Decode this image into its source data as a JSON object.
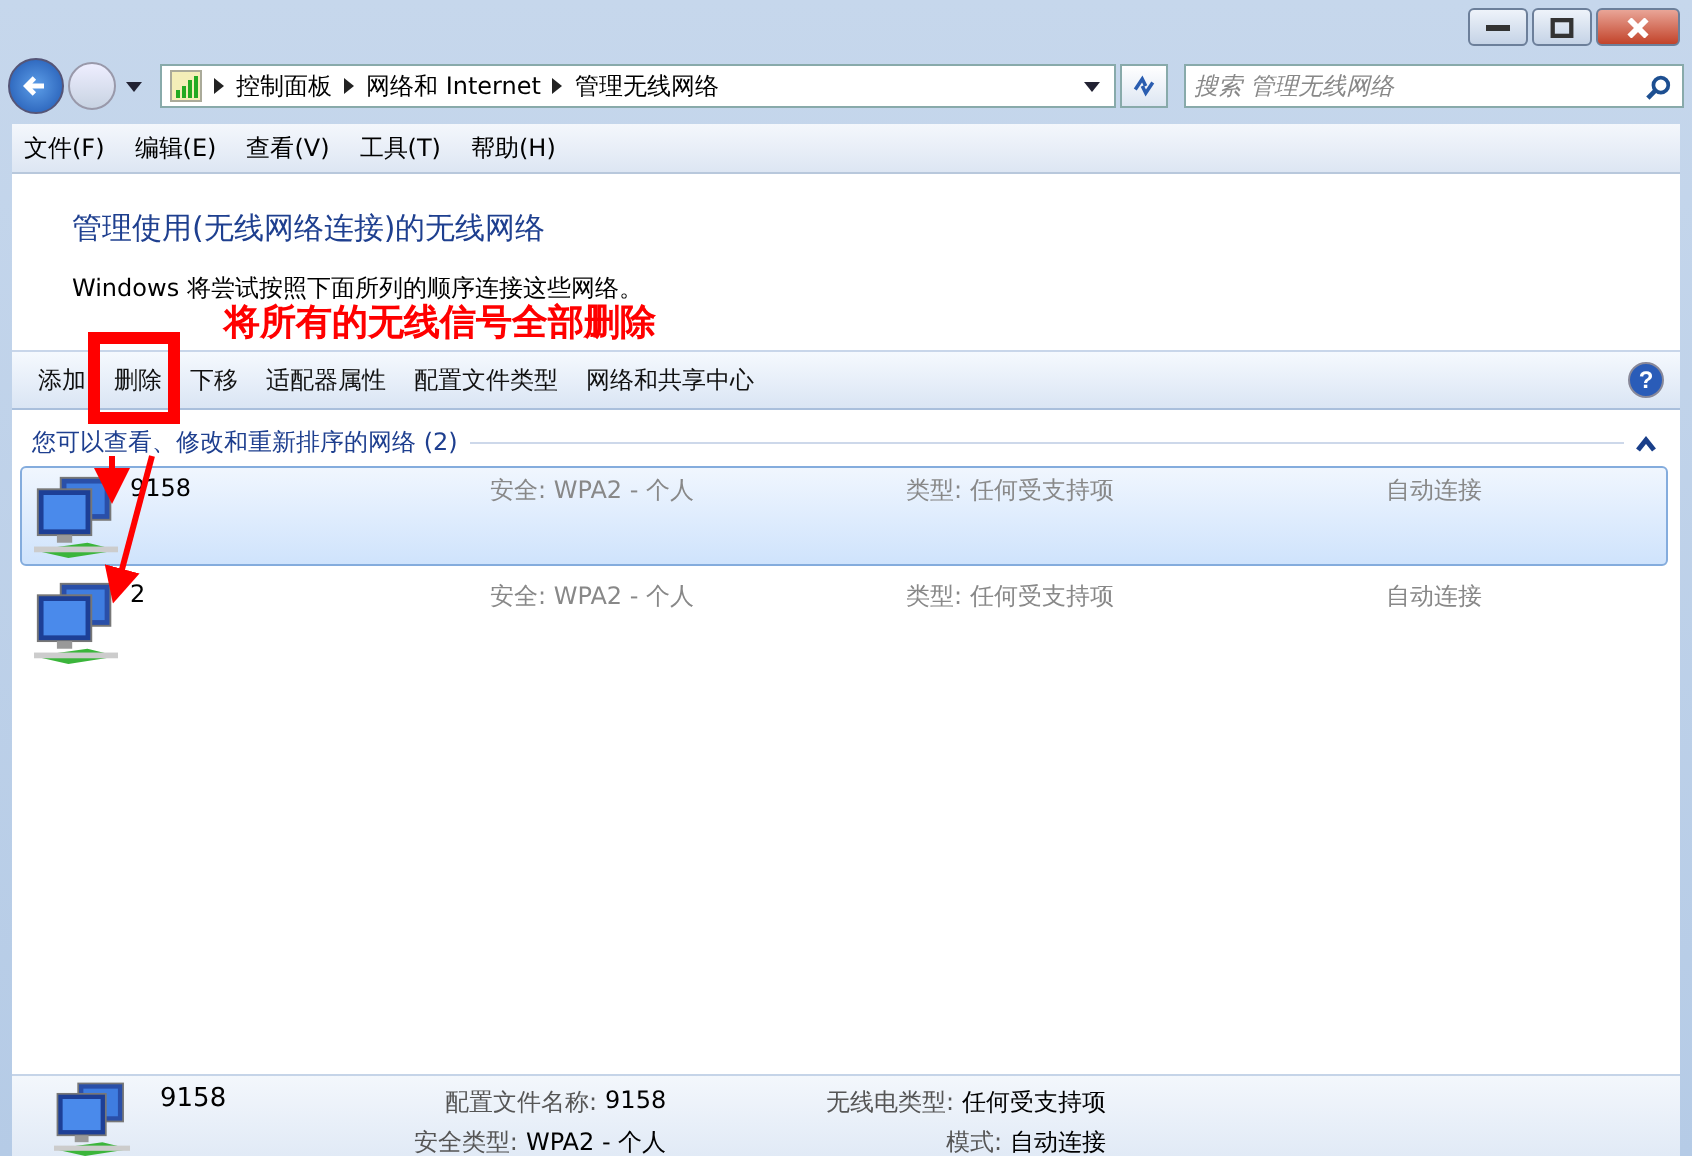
{
  "address": {
    "crumbs": [
      "控制面板",
      "网络和 Internet",
      "管理无线网络"
    ]
  },
  "search": {
    "placeholder": "搜索 管理无线网络"
  },
  "menu": [
    "文件(F)",
    "编辑(E)",
    "查看(V)",
    "工具(T)",
    "帮助(H)"
  ],
  "heading": "管理使用(无线网络连接)的无线网络",
  "description": "Windows 将尝试按照下面所列的顺序连接这些网络。",
  "toolbar": [
    {
      "label": "添加"
    },
    {
      "label": "删除"
    },
    {
      "label": "下移"
    },
    {
      "label": "适配器属性"
    },
    {
      "label": "配置文件类型"
    },
    {
      "label": "网络和共享中心"
    }
  ],
  "help": {
    "label": "?"
  },
  "group": {
    "title": "您可以查看、修改和重新排序的网络 (2)",
    "expanded": true
  },
  "networks": [
    {
      "name": "9158",
      "security": "安全: WPA2 - 个人",
      "type": "类型: 任何受支持项",
      "mode": "自动连接",
      "selected": true
    },
    {
      "name": "2",
      "security": "安全: WPA2 - 个人",
      "type": "类型: 任何受支持项",
      "mode": "自动连接",
      "selected": false
    }
  ],
  "annotation": {
    "text": "将所有的无线信号全部删除"
  },
  "details": {
    "name": "9158",
    "fields": [
      {
        "label": "配置文件名称:",
        "value": "9158"
      },
      {
        "label": "无线电类型:",
        "value": "任何受支持项"
      },
      {
        "label": "安全类型:",
        "value": "WPA2 - 个人"
      },
      {
        "label": "模式:",
        "value": "自动连接"
      }
    ]
  }
}
